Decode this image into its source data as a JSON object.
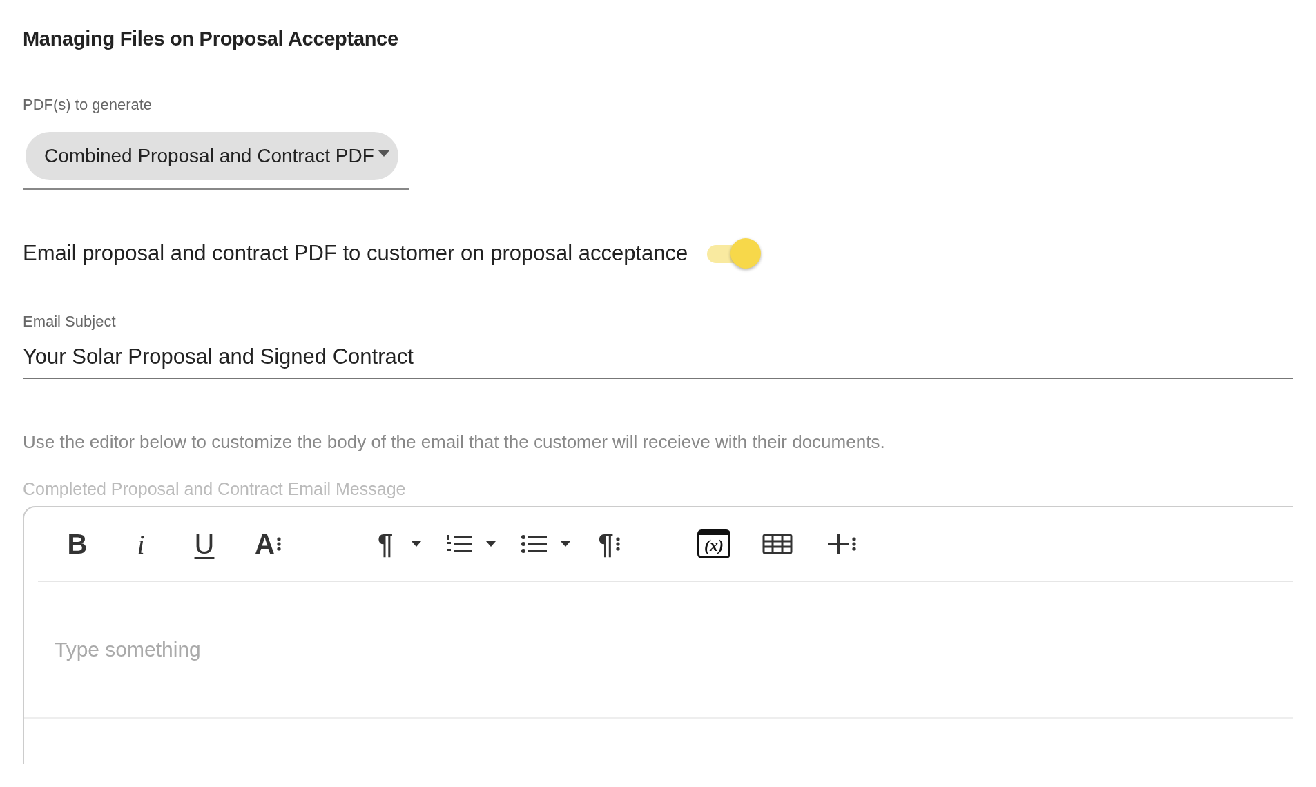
{
  "title": "Managing Files on Proposal Acceptance",
  "pdf_select": {
    "label": "PDF(s) to generate",
    "value": "Combined Proposal and Contract PDF"
  },
  "email_toggle": {
    "label": "Email proposal and contract PDF to customer on proposal acceptance",
    "on": true
  },
  "email_subject": {
    "label": "Email Subject",
    "value": "Your Solar Proposal and Signed Contract"
  },
  "helper_text": "Use the editor below to customize the body of the email that the customer will receieve with their documents.",
  "editor": {
    "label": "Completed Proposal and Contract Email Message",
    "placeholder": "Type something",
    "toolbar": [
      [
        {
          "kind": "bold",
          "glyph": "B"
        },
        {
          "kind": "italic",
          "glyph": "i"
        },
        {
          "kind": "underline",
          "glyph": "U"
        },
        {
          "kind": "font-size",
          "glyph": "A"
        }
      ],
      [
        {
          "kind": "paragraph-format",
          "glyph": "¶"
        },
        {
          "kind": "ordered-list"
        },
        {
          "kind": "unordered-list"
        },
        {
          "kind": "paragraph-more",
          "glyph": "¶"
        }
      ],
      [
        {
          "kind": "variable",
          "glyph": "(x)"
        },
        {
          "kind": "table"
        },
        {
          "kind": "insert-more"
        }
      ]
    ]
  }
}
